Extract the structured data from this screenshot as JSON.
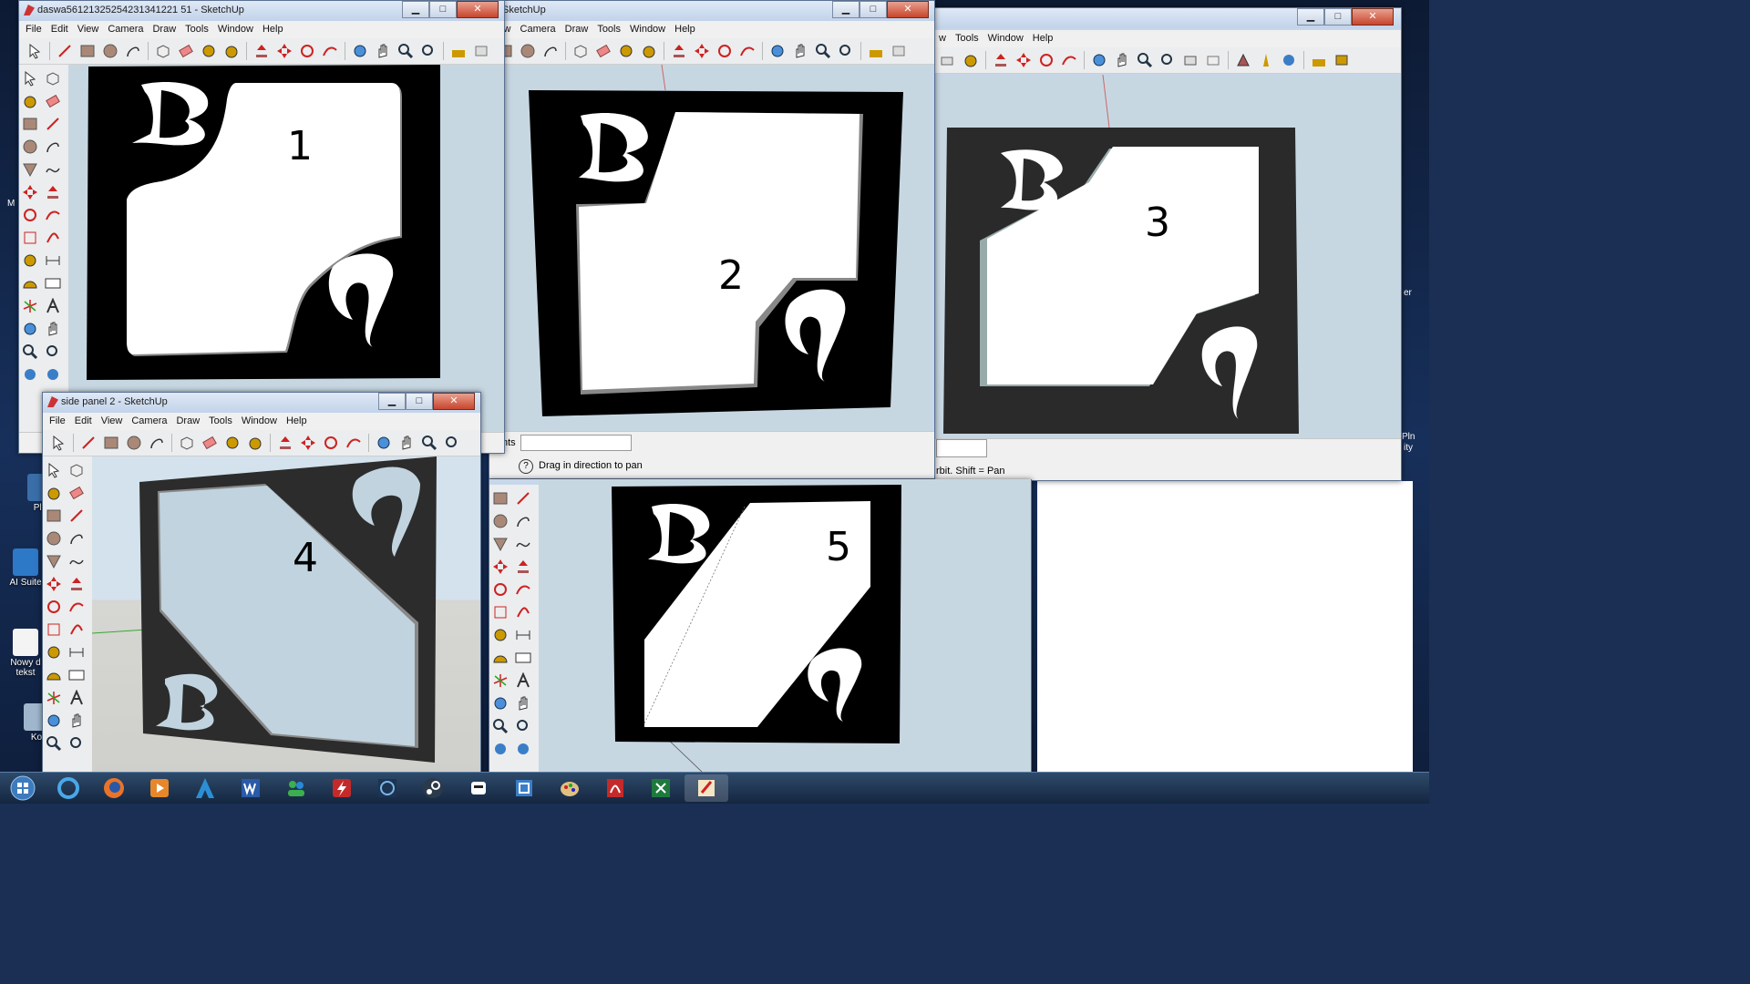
{
  "windows": {
    "w1": {
      "title": "daswa56121325254231341221 51 - SketchUp",
      "panel_number": "1"
    },
    "w2": {
      "title": "SketchUp",
      "panel_number": "2",
      "status_text": "Drag in direction to pan",
      "status_prefix": "nts"
    },
    "w3": {
      "panel_number": "3",
      "status_text": "rbit.  Shift = Pan"
    },
    "w4": {
      "title": "side panel 2 - SketchUp",
      "panel_number": "4"
    },
    "w5": {
      "panel_number": "5"
    }
  },
  "menus": [
    "File",
    "Edit",
    "View",
    "Camera",
    "Draw",
    "Tools",
    "Window",
    "Help"
  ],
  "menus_partial": [
    "iew",
    "Camera",
    "Draw",
    "Tools",
    "Window",
    "Help"
  ],
  "menus_partial3": [
    "w",
    "Tools",
    "Window",
    "Help"
  ],
  "desktop_icons": [
    {
      "label": "Pla"
    },
    {
      "label": "AI Suite"
    },
    {
      "label": "Nowy d tekst"
    },
    {
      "label": "Ko"
    }
  ],
  "desktop_right_text": [
    "er",
    "Pln",
    "ity"
  ],
  "desktop_left_text": "M",
  "window_caption_glyphs": {
    "minimize": "▁",
    "maximize": "□",
    "close": "✕"
  },
  "taskbar_icons": [
    "windows-start",
    "internet-explorer",
    "firefox",
    "media-player",
    "atlas",
    "word",
    "people",
    "flash",
    "fan",
    "steam",
    "robot",
    "sketch",
    "paint",
    "acrobat",
    "excel",
    "pen"
  ],
  "colors": {
    "panel_black": "#000000",
    "panel_dark": "#2a2a2a",
    "cutout_white": "#ffffff",
    "glass": "#c0d3df",
    "viewport": "#c7d7e2"
  }
}
